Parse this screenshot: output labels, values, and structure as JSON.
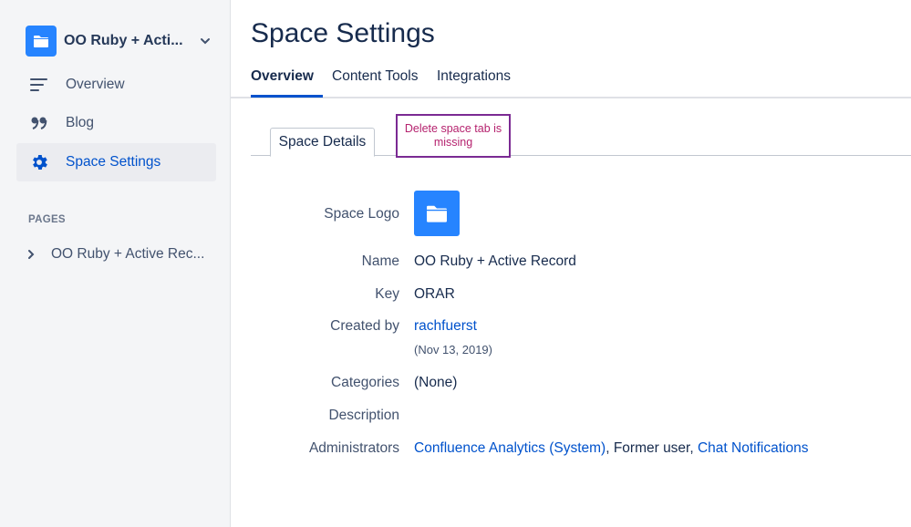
{
  "sidebar": {
    "space_name": "OO Ruby + Acti...",
    "nav_items": [
      {
        "label": "Overview",
        "icon": "overview-lines-icon"
      },
      {
        "label": "Blog",
        "icon": "quote-icon"
      },
      {
        "label": "Space Settings",
        "icon": "gear-icon",
        "active": true
      }
    ],
    "pages_heading": "PAGES",
    "page_tree": [
      {
        "label": "OO Ruby + Active Rec..."
      }
    ]
  },
  "header": {
    "title": "Space Settings",
    "tabs": [
      {
        "label": "Overview",
        "active": true
      },
      {
        "label": "Content Tools"
      },
      {
        "label": "Integrations"
      }
    ]
  },
  "sub_tabs": [
    {
      "label": "Space Details",
      "active": true
    }
  ],
  "annotation": {
    "text": "Delete space tab is missing"
  },
  "details": {
    "space_logo_label": "Space Logo",
    "name_label": "Name",
    "name_value": "OO Ruby + Active Record",
    "key_label": "Key",
    "key_value": "ORAR",
    "created_by_label": "Created by",
    "created_by_value": "rachfuerst",
    "created_date": "(Nov 13, 2019)",
    "categories_label": "Categories",
    "categories_value": "(None)",
    "description_label": "Description",
    "administrators_label": "Administrators",
    "administrators": {
      "admin_1": "Confluence Analytics (System)",
      "sep_1": ", Former user, ",
      "admin_2": "Chat Notifications"
    }
  },
  "colors": {
    "accent": "#0052cc",
    "space_avatar": "#2684ff",
    "annotation_border": "#7b2a93",
    "annotation_text": "#b5226e"
  }
}
